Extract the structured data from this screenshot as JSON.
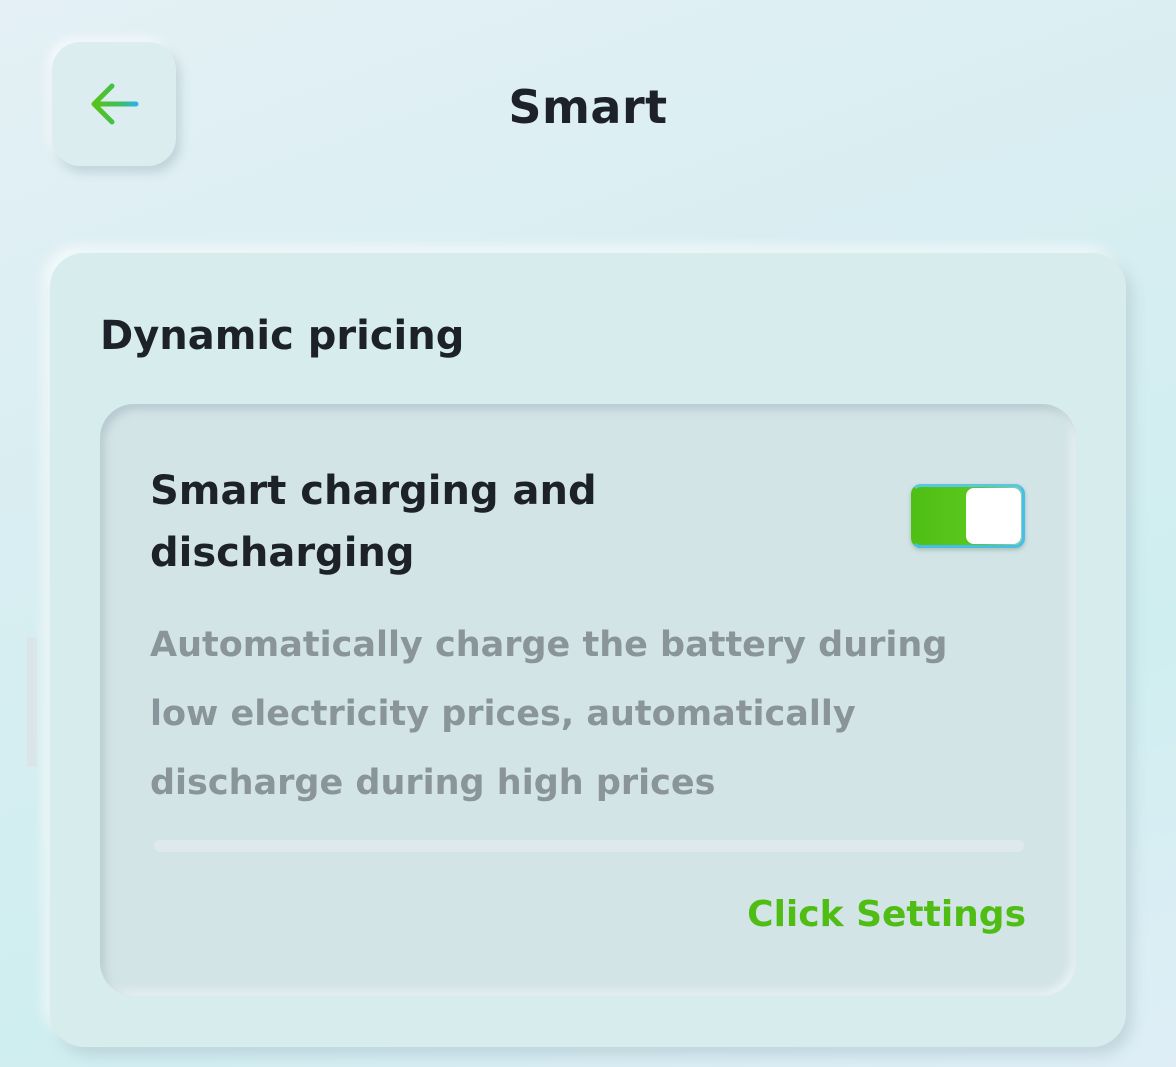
{
  "header": {
    "title": "Smart",
    "back_icon": "arrow-left-icon"
  },
  "section": {
    "title": "Dynamic pricing",
    "feature": {
      "title": "Smart charging and discharging",
      "enabled": true,
      "description": "Automatically charge the battery during low electricity prices, automatically discharge during high prices",
      "settings_link": "Click Settings"
    }
  },
  "colors": {
    "accent_green": "#4fbd14",
    "toggle_border": "#48bde8",
    "title_text": "#1d222a",
    "muted_text": "#8a949b"
  }
}
